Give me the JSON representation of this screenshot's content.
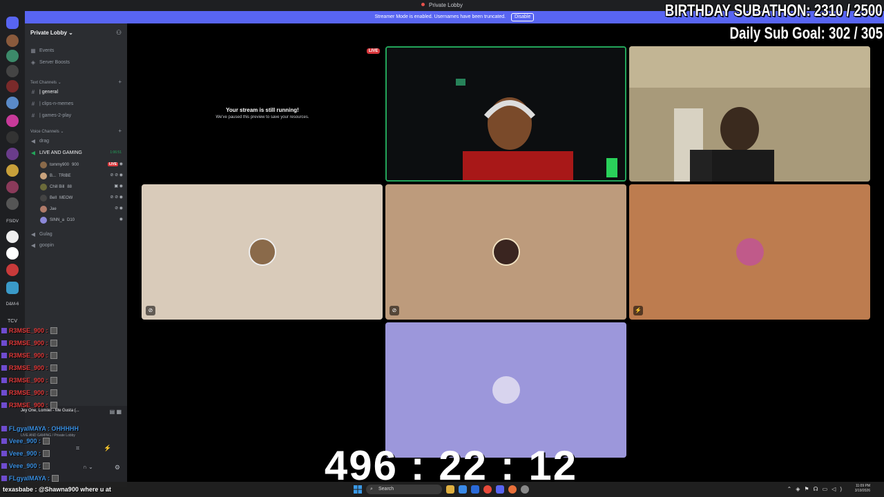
{
  "window": {
    "title": "Private Lobby"
  },
  "banner": {
    "text": "Streamer Mode is enabled. Usernames have been truncated.",
    "disable_label": "Disable"
  },
  "overlay": {
    "subathon": "BIRTHDAY SUBATHON:  2310 / 2500",
    "daily_goal": "Daily Sub Goal:  302 / 305",
    "timer": "496 : 22 : 12"
  },
  "rail_labels": {
    "a": "FSIDV",
    "b": "D&M-6",
    "c": "TCV"
  },
  "server": {
    "name": "Private Lobby",
    "top_items": [
      "Events",
      "Server Boosts"
    ],
    "text_category": "Text Channels",
    "text_channels": [
      "| general",
      "| clips-n-memes",
      "| games-2-play"
    ],
    "voice_category": "Voice Channels",
    "voice_channels": {
      "drag": "drag",
      "live": "LIVE AND GAMING",
      "live_time": "1:06:51",
      "gulag": "Gulag",
      "goopin": "goopin"
    },
    "voice_users": [
      {
        "name": "tommy900",
        "badge": "900",
        "live": "LIVE",
        "color": "#8a6a4a"
      },
      {
        "name": "B...",
        "badge": "TRIBE",
        "color": "#c9a27c"
      },
      {
        "name": "Chill Bill",
        "badge": "88",
        "color": "#6b6b3a"
      },
      {
        "name": "Bell",
        "badge": "MEOW",
        "color": "#444"
      },
      {
        "name": "Jae",
        "badge": "",
        "color": "#b07b6a"
      },
      {
        "name": "SINN_a",
        "badge": "D10",
        "color": "#8c88d8"
      }
    ]
  },
  "stage": {
    "live_pill": "LIVE",
    "paused_title": "Your stream is still running!",
    "paused_sub": "We've paused this preview to save your resources."
  },
  "chat": {
    "lines": [
      {
        "user": "R3MSE_900 :",
        "color": "red"
      },
      {
        "user": "R3MSE_900 :",
        "color": "red"
      },
      {
        "user": "R3MSE_900 :",
        "color": "red"
      },
      {
        "user": "R3MSE_900 :",
        "color": "red"
      },
      {
        "user": "R3MSE_900 :",
        "color": "red"
      },
      {
        "user": "R3MSE_900 :",
        "color": "red"
      },
      {
        "user": "R3MSE_900 :",
        "color": "red"
      }
    ],
    "now_playing": "Jey One, Lomiiel - Me Gusta (...",
    "line_maya": "FLgyalMAYA : OHHHHH",
    "voice_status": "LIVE AND GAMING / Private Lobby",
    "veee1": "Veee_900 :",
    "veee2": "Veee_900 :",
    "veee3": "Veee_900 :",
    "maya2": "FLgyalMAYA :",
    "bottom": "texasbabe : @Shawna900 where u at"
  },
  "taskbar": {
    "search": "Search",
    "time": "11:09 PM",
    "date": "3/19/2026"
  }
}
